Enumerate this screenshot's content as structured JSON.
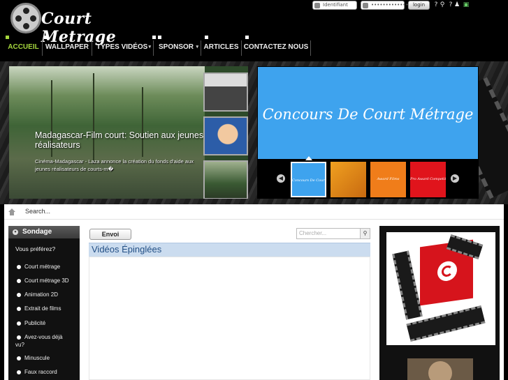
{
  "site": {
    "logo_text": "Court Metrage"
  },
  "login": {
    "username_placeholder": "Identifiant",
    "password_placeholder": "•••••••••••••",
    "login_label": "login"
  },
  "nav": {
    "items": [
      {
        "label": "ACCUEIL",
        "active": true
      },
      {
        "label": "WALLPAPER"
      },
      {
        "label": "TYPES VIDÉOS",
        "has_submenu": true
      },
      {
        "label": "SPONSOR",
        "has_submenu": true
      },
      {
        "label": "ARTICLES"
      },
      {
        "label": "CONTACTEZ NOUS"
      }
    ]
  },
  "slider": {
    "title": "Madagascar-Film court: Soutien aux jeunes réalisateurs",
    "text": "Cinéma-Madagascar - Laza annonce la création du fonds d'aide aux jeunes réalisateurs de courts-m�"
  },
  "promo": {
    "banner_text": "Concours De Court Métrage",
    "tile_labels": [
      "Concours De Court Métrage",
      "",
      "Award Films",
      "Pro Award Competition"
    ],
    "colors": {
      "banner": "#3ea3ee",
      "tile_orange": "#f07d1a",
      "tile_red": "#e0141c"
    }
  },
  "breadcrumb": {
    "search_label": "Search..."
  },
  "poll": {
    "title": "Sondage",
    "question": "Vous préférez?",
    "options": [
      "Court métrage",
      "Court métrage 3D",
      "Animation 2D",
      "Extrait de films",
      "Publicité",
      "Avez-vous déjà vu?",
      "Minuscule",
      "Faux raccord"
    ]
  },
  "main": {
    "envoi_label": "Envoi",
    "search_placeholder": "Chercher...",
    "pinned_title": "Vidéos Épinglées"
  },
  "icons": {
    "user": "user-icon",
    "password": "key-icon",
    "help": "help-icon",
    "register": "register-icon",
    "home": "home-icon",
    "search": "search-icon"
  }
}
